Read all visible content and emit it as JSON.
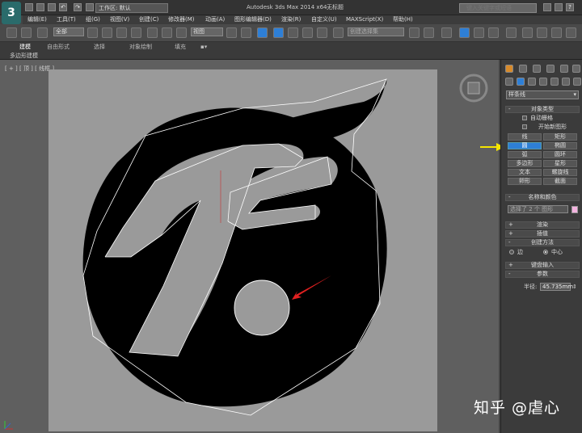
{
  "titlebar": {
    "app_logo": "3",
    "workspace": "工作区: 默认",
    "app_title": "Autodesk 3ds Max 2014 x64",
    "file_title": "无标题",
    "search_placeholder": "键入关键字或短语"
  },
  "menu": [
    "编辑(E)",
    "工具(T)",
    "组(G)",
    "视图(V)",
    "创建(C)",
    "修改器(M)",
    "动画(A)",
    "图形编辑器(D)",
    "渲染(R)",
    "自定义(U)",
    "MAXScript(X)",
    "帮助(H)"
  ],
  "toolbar": {
    "selection_filter": "全部",
    "view_coord": "视图",
    "named_selection": "创建选择集"
  },
  "ribbon": {
    "tabs": [
      "建模",
      "自由形式",
      "选择",
      "对象绘制",
      "填充"
    ],
    "sub_label": "多边形建模"
  },
  "viewport": {
    "label": "[ + ] [ 顶 ] [ 线框 ]"
  },
  "panel": {
    "category": "样条线",
    "object_type": {
      "title": "对象类型",
      "auto_grid": "自动栅格",
      "start_new_shape": "开始新图形",
      "buttons": [
        "线",
        "矩形",
        "圆",
        "椭圆",
        "弧",
        "圆环",
        "多边形",
        "星形",
        "文本",
        "螺旋线",
        "卵形",
        "截面"
      ],
      "active_button": "圆"
    },
    "name_color": {
      "title": "名称和颜色",
      "value": "选择了 2 个 图形",
      "color": "#f4b3e0"
    },
    "render_rollout": "渲染",
    "interp_rollout": "插值",
    "creation_method": {
      "title": "创建方法",
      "options": [
        "边",
        "中心"
      ],
      "selected": "中心"
    },
    "keyboard_rollout": "键盘输入",
    "parameters": {
      "title": "参数",
      "radius_label": "半径:",
      "radius_value": "45.735mm"
    }
  },
  "watermark": "知乎 @虐心",
  "colors": {
    "highlight": "#2e7fd6",
    "arrow_red": "#e02020",
    "arrow_yellow": "#f5e500"
  }
}
